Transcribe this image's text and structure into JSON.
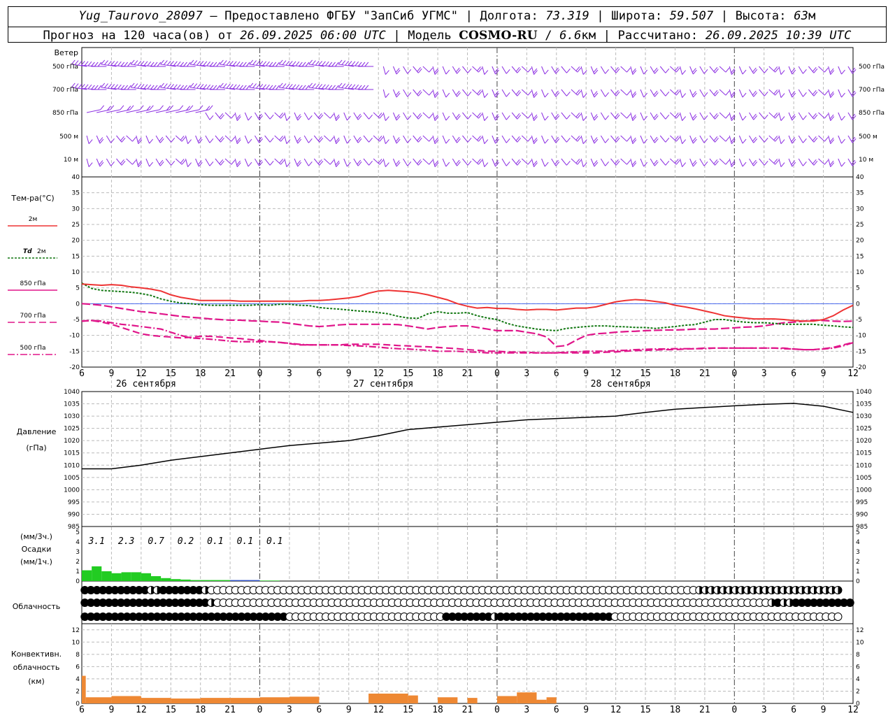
{
  "header": {
    "station": "Yug_Taurovo_28097",
    "provider": "– Предоставлено ФГБУ \"ЗапСиб УГМС\"",
    "lon_label": "Долгота:",
    "lon": "73.319",
    "lat_label": "Широта:",
    "lat": "59.507",
    "alt_label": "Высота:",
    "alt": "63",
    "alt_unit": "м",
    "forecast_prefix": "Прогноз на 120 часа(ов) от",
    "forecast_time": "26.09.2025 06:00 UTC",
    "model_label": "Модель",
    "model": "COSMO-RU",
    "resolution": "6.6",
    "res_unit": "км",
    "computed_label": "Рассчитано:",
    "computed_time": "26.09.2025 10:39 UTC"
  },
  "wind_panel": {
    "title": "Ветер",
    "levels": [
      "500 гПа",
      "700 гПа",
      "850 гПа",
      "500 м",
      "10 м"
    ],
    "color": "#8a2be2"
  },
  "x_axis": {
    "tick_labels": [
      "6",
      "9",
      "12",
      "15",
      "18",
      "21",
      "0",
      "3",
      "6",
      "9",
      "12",
      "15",
      "18",
      "21",
      "0",
      "3",
      "6",
      "9",
      "12",
      "15",
      "18",
      "21",
      "0",
      "3",
      "6",
      "9",
      "12"
    ],
    "days": [
      "26 сентября",
      "27 сентября",
      "28 сентября"
    ]
  },
  "legends": {
    "temp_title": "Тем-ра(°C)",
    "t2m": "2м",
    "td_symbol": "Td",
    "td": "2м",
    "t850": "850 гПа",
    "t700": "700 гПа",
    "t500": "500 гПа",
    "pressure_title": "Давление",
    "pressure_unit": "(гПа)",
    "precip_unit_3h": "(мм/3ч.)",
    "precip_title": "Осадки",
    "precip_unit_1h": "(мм/1ч.)",
    "cloud_title": "Облачность",
    "conv_title_1": "Конвективн.",
    "conv_title_2": "облачность",
    "conv_unit": "(км)"
  },
  "chart_data": [
    {
      "type": "line",
      "name": "temperature",
      "x_hours": [
        0,
        1,
        2,
        3,
        4,
        5,
        6,
        7,
        8,
        9,
        10,
        11,
        12,
        13,
        14,
        15,
        16,
        17,
        18,
        19,
        20,
        21,
        22,
        23,
        24,
        25,
        26,
        27,
        28,
        29,
        30,
        31,
        32,
        33,
        34,
        35,
        36,
        37,
        38,
        39,
        40,
        41,
        42,
        43,
        44,
        45,
        46,
        47,
        48,
        49,
        50,
        51,
        52,
        53,
        54,
        55,
        56,
        57,
        58,
        59,
        60,
        61,
        62,
        63,
        64,
        65,
        66,
        67,
        68,
        69,
        70,
        71,
        72,
        73,
        74,
        75,
        76,
        77,
        78
      ],
      "ylim": [
        -20,
        40
      ],
      "yticks": [
        -20,
        -15,
        -10,
        -5,
        0,
        5,
        10,
        15,
        20,
        25,
        30,
        35,
        40
      ],
      "colors": {
        "t2m": "#ee3333",
        "td": "#117711",
        "t850": "#e0158a",
        "t700": "#e0158a",
        "t500": "#e0158a"
      },
      "series": [
        {
          "name": "2м",
          "key": "t2m",
          "values": [
            6.2,
            6.0,
            5.8,
            6.0,
            5.8,
            5.3,
            5.0,
            4.6,
            4.0,
            2.8,
            2.0,
            1.5,
            1.0,
            1.0,
            1.0,
            1.0,
            0.8,
            0.8,
            0.8,
            0.8,
            0.8,
            0.8,
            0.8,
            1.0,
            1.0,
            1.2,
            1.5,
            1.8,
            2.3,
            3.3,
            4.0,
            4.2,
            4.0,
            3.8,
            3.4,
            2.8,
            2.0,
            1.2,
            0.0,
            -0.8,
            -1.4,
            -1.2,
            -1.5,
            -1.5,
            -1.8,
            -2.0,
            -1.8,
            -1.8,
            -2.0,
            -1.7,
            -1.4,
            -1.4,
            -1.0,
            -0.2,
            0.6,
            1.0,
            1.3,
            1.1,
            0.7,
            0.3,
            -0.5,
            -1.0,
            -1.6,
            -2.3,
            -3.0,
            -3.8,
            -4.2,
            -4.5,
            -4.8,
            -4.8,
            -4.8,
            -5.0,
            -5.3,
            -5.5,
            -5.5,
            -5.0,
            -3.8,
            -2.0,
            -0.5
          ]
        },
        {
          "name": "Td 2м",
          "key": "td",
          "values": [
            6.5,
            4.8,
            4.2,
            4.0,
            3.8,
            3.6,
            3.2,
            2.6,
            1.5,
            0.8,
            0.2,
            0.0,
            -0.3,
            -0.5,
            -0.5,
            -0.5,
            -0.5,
            -0.5,
            -0.3,
            -0.5,
            -0.2,
            -0.2,
            -0.5,
            -0.6,
            -1.2,
            -1.5,
            -1.7,
            -2.0,
            -2.3,
            -2.5,
            -2.8,
            -3.2,
            -4.0,
            -4.5,
            -4.6,
            -3.2,
            -2.5,
            -3.0,
            -3.0,
            -2.8,
            -3.8,
            -4.5,
            -5.0,
            -6.2,
            -7.0,
            -7.5,
            -8.0,
            -8.3,
            -8.5,
            -7.8,
            -7.5,
            -7.2,
            -7.0,
            -7.0,
            -7.2,
            -7.3,
            -7.5,
            -7.5,
            -7.8,
            -7.5,
            -7.2,
            -6.8,
            -6.6,
            -5.8,
            -5.0,
            -5.0,
            -5.5,
            -5.8,
            -6.0,
            -6.0,
            -6.2,
            -6.5,
            -6.5,
            -6.5,
            -6.5,
            -6.8,
            -7.0,
            -7.3,
            -7.5
          ]
        },
        {
          "name": "850 гПа",
          "key": "t850",
          "values": [
            0.0,
            -0.2,
            -0.5,
            -1.0,
            -1.5,
            -2.0,
            -2.5,
            -2.8,
            -3.2,
            -3.6,
            -4.0,
            -4.3,
            -4.5,
            -4.8,
            -5.0,
            -5.2,
            -5.2,
            -5.4,
            -5.5,
            -5.7,
            -5.8,
            -6.2,
            -6.6,
            -7.0,
            -7.2,
            -7.0,
            -6.7,
            -6.5,
            -6.5,
            -6.5,
            -6.5,
            -6.5,
            -6.6,
            -7.0,
            -7.5,
            -8.0,
            -7.5,
            -7.2,
            -7.0,
            -7.0,
            -7.5,
            -8.0,
            -8.5,
            -8.5,
            -8.5,
            -9.0,
            -9.5,
            -10.5,
            -13.5,
            -13.2,
            -11.5,
            -10.0,
            -9.5,
            -9.3,
            -9.0,
            -8.8,
            -8.7,
            -8.5,
            -8.4,
            -8.3,
            -8.3,
            -8.2,
            -8.0,
            -8.0,
            -8.0,
            -7.8,
            -7.6,
            -7.4,
            -7.3,
            -7.0,
            -6.5,
            -6.0,
            -5.8,
            -5.5,
            -5.2,
            -5.3,
            -5.5,
            -5.6,
            -5.5
          ]
        },
        {
          "name": "700 гПа",
          "key": "t700",
          "values": [
            -5.5,
            -5.3,
            -5.8,
            -6.5,
            -7.5,
            -8.5,
            -9.5,
            -10.0,
            -10.3,
            -10.5,
            -10.8,
            -10.6,
            -10.3,
            -10.3,
            -10.5,
            -10.8,
            -11.0,
            -11.3,
            -11.6,
            -12.0,
            -12.2,
            -12.6,
            -13.0,
            -13.0,
            -13.0,
            -13.0,
            -13.0,
            -12.8,
            -12.8,
            -12.8,
            -12.8,
            -13.0,
            -13.2,
            -13.3,
            -13.5,
            -13.6,
            -13.8,
            -14.0,
            -14.2,
            -14.5,
            -14.7,
            -15.0,
            -15.0,
            -15.2,
            -15.3,
            -15.3,
            -15.5,
            -15.5,
            -15.5,
            -15.5,
            -15.5,
            -15.5,
            -15.5,
            -15.3,
            -15.2,
            -15.0,
            -14.8,
            -14.7,
            -14.6,
            -14.5,
            -14.5,
            -14.3,
            -14.2,
            -14.0,
            -14.0,
            -14.0,
            -14.0,
            -14.0,
            -14.0,
            -14.0,
            -14.0,
            -14.0,
            -14.3,
            -14.5,
            -14.5,
            -14.2,
            -13.8,
            -13.0,
            -12.2
          ]
        },
        {
          "name": "500 гПа",
          "key": "t500",
          "values": [
            -5.5,
            -5.3,
            -5.5,
            -6.0,
            -6.5,
            -6.8,
            -7.2,
            -7.6,
            -8.0,
            -9.0,
            -10.0,
            -10.8,
            -11.0,
            -11.2,
            -11.5,
            -11.8,
            -12.0,
            -12.0,
            -12.0,
            -12.0,
            -12.2,
            -12.5,
            -12.8,
            -13.0,
            -13.0,
            -13.0,
            -13.0,
            -13.2,
            -13.3,
            -13.5,
            -13.7,
            -14.0,
            -14.2,
            -14.3,
            -14.5,
            -14.7,
            -15.0,
            -15.0,
            -15.0,
            -15.2,
            -15.3,
            -15.5,
            -15.5,
            -15.5,
            -15.5,
            -15.5,
            -15.5,
            -15.5,
            -15.5,
            -15.3,
            -15.2,
            -15.0,
            -15.0,
            -15.0,
            -14.8,
            -14.7,
            -14.5,
            -14.4,
            -14.3,
            -14.3,
            -14.2,
            -14.2,
            -14.2,
            -14.2,
            -14.0,
            -14.0,
            -14.0,
            -14.0,
            -14.0,
            -14.0,
            -14.0,
            -14.2,
            -14.3,
            -14.5,
            -14.5,
            -14.3,
            -14.0,
            -13.3,
            -12.3
          ]
        }
      ]
    },
    {
      "type": "line",
      "name": "pressure",
      "x_hours": [
        0,
        3,
        6,
        9,
        12,
        15,
        18,
        21,
        24,
        27,
        30,
        33,
        36,
        39,
        42,
        45,
        48,
        51,
        54,
        57,
        60,
        63,
        66,
        69,
        72,
        75,
        78
      ],
      "values": [
        1008.5,
        1008.5,
        1010.0,
        1012.0,
        1013.5,
        1015.0,
        1016.5,
        1018.0,
        1019.0,
        1020.0,
        1022.0,
        1024.5,
        1025.5,
        1026.5,
        1027.5,
        1028.5,
        1029.0,
        1029.5,
        1030.0,
        1031.5,
        1032.8,
        1033.5,
        1034.2,
        1034.8,
        1035.2,
        1034.0,
        1031.5
      ],
      "ylim": [
        985,
        1040
      ],
      "yticks": [
        985,
        990,
        995,
        1000,
        1005,
        1010,
        1015,
        1020,
        1025,
        1030,
        1035,
        1040
      ],
      "color": "#000000"
    },
    {
      "type": "bar",
      "name": "precipitation",
      "x_hours": [
        0,
        1,
        2,
        3,
        4,
        5,
        6,
        7,
        8,
        9,
        10,
        11,
        12,
        13,
        14,
        15,
        16,
        17,
        18,
        19
      ],
      "values": [
        1.1,
        1.5,
        1.0,
        0.8,
        0.9,
        0.9,
        0.8,
        0.5,
        0.3,
        0.2,
        0.15,
        0.1,
        0.1,
        0.1,
        0.1,
        0.1,
        0.1,
        0.1,
        0.05,
        0.05
      ],
      "colors": [
        "#22cc22",
        "#22cc22",
        "#22cc22",
        "#22cc22",
        "#22cc22",
        "#22cc22",
        "#22cc22",
        "#22cc22",
        "#22cc22",
        "#22cc22",
        "#22cc22",
        "#22cc22",
        "#22cc22",
        "#22cc22",
        "#22cc22",
        "#3355cc",
        "#3355cc",
        "#3355cc",
        "#22cc22",
        "#22cc22"
      ],
      "totals_3h": [
        "3.1",
        "2.3",
        "0.7",
        "0.2",
        "0.1",
        "0.1",
        "0.1"
      ],
      "ylim": [
        0,
        5
      ],
      "yticks": [
        0,
        1,
        2,
        3,
        4,
        5
      ]
    },
    {
      "type": "table",
      "name": "cloud_cover",
      "legend_levels": [
        "high",
        "middle",
        "low"
      ],
      "rows": [
        "FFFFFFFFFFFHHFFFFFFFHEEEEEEEEEEEEEEEEEEEEEEEEEEEEEEEEEEEEEEEEEEEEEEEEEEEEEEEEEEEEEEEEEEEEEEEEEEEEEEEEEHHHHHHHHHHHHHHHHHHHHHHHH",
        "FFFFFFFFFFFFFFFFFFFFFHEEEEEEEEEEEEEEEEEEEEEEEEEEEEEEEEEEEEEEEEEEEEEEEEEEEEEEEEEEEEEEEEEEEEEEEEEEEEEEEEEEEEEEEEEEEEHFHHFFFFFFFFFF",
        "FFFFFFFFFFFFFFFFFFFFFFFFFFFFFFFFFFEEEEEEEEEEEEEEEEEEEEEEEEEEFFFFFFFFHFFFFFFFFFFFFFFFFFFFEEEEEEEEEEEEEEEEEEEEEEEEEEEEEEEEEEEEEE"
      ],
      "symbols": {
        "F": "overcast",
        "H": "half",
        "E": "clear"
      }
    },
    {
      "type": "bar",
      "name": "convective_clouds",
      "segments": [
        {
          "from": 0,
          "to": 0.4,
          "value": 4.5
        },
        {
          "from": 0.4,
          "to": 3,
          "value": 1.0
        },
        {
          "from": 3,
          "to": 6,
          "value": 1.2
        },
        {
          "from": 6,
          "to": 9,
          "value": 0.9
        },
        {
          "from": 9,
          "to": 12,
          "value": 0.8
        },
        {
          "from": 12,
          "to": 15,
          "value": 0.9
        },
        {
          "from": 15,
          "to": 18,
          "value": 0.9
        },
        {
          "from": 18,
          "to": 21,
          "value": 1.0
        },
        {
          "from": 21,
          "to": 24,
          "value": 1.1
        },
        {
          "from": 29,
          "to": 33,
          "value": 1.6
        },
        {
          "from": 33,
          "to": 34,
          "value": 1.3
        },
        {
          "from": 36,
          "to": 38,
          "value": 1.0
        },
        {
          "from": 39,
          "to": 40,
          "value": 0.9
        },
        {
          "from": 42,
          "to": 44,
          "value": 1.2
        },
        {
          "from": 44,
          "to": 46,
          "value": 1.8
        },
        {
          "from": 46,
          "to": 47,
          "value": 0.6
        },
        {
          "from": 47,
          "to": 48,
          "value": 1.0
        }
      ],
      "color": "#ee8833",
      "ylim": [
        0,
        13
      ],
      "yticks": [
        0,
        2,
        4,
        6,
        8,
        10,
        12
      ]
    }
  ]
}
